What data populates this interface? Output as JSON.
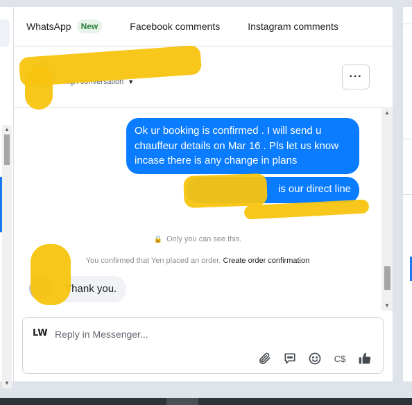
{
  "tabs": [
    {
      "label": "WhatsApp",
      "badge": "New"
    },
    {
      "label": "Facebook comments"
    },
    {
      "label": "Instagram comments"
    }
  ],
  "header": {
    "contact_name": "",
    "conversation_status": "nigh conversation",
    "more_label": "···"
  },
  "messages": {
    "outgoing_1": "Ok ur booking is confirmed . I will send u chauffeur details on Mar 16 . Pls let us know incase there is any change in plans",
    "outgoing_2": "is our direct line",
    "privacy_notice": "Only you can see this.",
    "system_text": "You confirmed that Yen placed an order.",
    "system_link": "Create order confirmation",
    "incoming_1": "Thank you."
  },
  "composer": {
    "page_avatar": "LW",
    "placeholder": "Reply in Messenger...",
    "currency_label": "C$"
  },
  "icons": {
    "attach": "paperclip-icon",
    "saved_replies": "chat-bubble-icon",
    "emoji": "smiley-icon",
    "currency": "currency-icon",
    "like": "thumbs-up-icon"
  },
  "colors": {
    "outgoing_bubble": "#0a7cff",
    "incoming_bubble": "#f0f2f5",
    "accent": "#1877f2",
    "redaction": "#f8c40f"
  }
}
